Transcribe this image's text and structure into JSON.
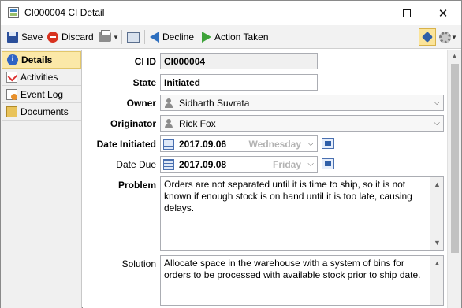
{
  "window": {
    "title": "CI000004 CI Detail",
    "min_glyph": "minimize-icon",
    "max_glyph": "maximize-icon",
    "close_glyph": "✕"
  },
  "toolbar": {
    "save_label": "Save",
    "discard_label": "Discard",
    "decline_label": "Decline",
    "action_taken_label": "Action Taken"
  },
  "nav": {
    "items": [
      {
        "label": "Details",
        "icon": "info-icon",
        "active": true
      },
      {
        "label": "Activities",
        "icon": "activities-icon",
        "active": false
      },
      {
        "label": "Event Log",
        "icon": "event-log-icon",
        "active": false
      },
      {
        "label": "Documents",
        "icon": "documents-icon",
        "active": false
      }
    ]
  },
  "form": {
    "ci_id": {
      "label": "CI ID",
      "value": "CI000004"
    },
    "state": {
      "label": "State",
      "value": "Initiated"
    },
    "owner": {
      "label": "Owner",
      "value": "Sidharth Suvrata"
    },
    "originator": {
      "label": "Originator",
      "value": "Rick Fox"
    },
    "date_initiated": {
      "label": "Date Initiated",
      "value": "2017.09.06",
      "weekday": "Wednesday"
    },
    "date_due": {
      "label": "Date Due",
      "value": "2017.09.08",
      "weekday": "Friday"
    },
    "problem": {
      "label": "Problem",
      "value": "Orders are not separated until it is time to ship, so it is not known if enough stock is on hand until it is too late, causing delays."
    },
    "solution": {
      "label": "Solution",
      "value": "Allocate space in the warehouse with a system of bins for orders to be processed with available stock prior to ship date."
    }
  },
  "colors": {
    "active_nav_bg": "#fbe8a8",
    "toolbar_bg": "#f2f2f2",
    "discard_red": "#d8321f",
    "decline_blue": "#2e6fbf",
    "action_green": "#3ea33a"
  }
}
